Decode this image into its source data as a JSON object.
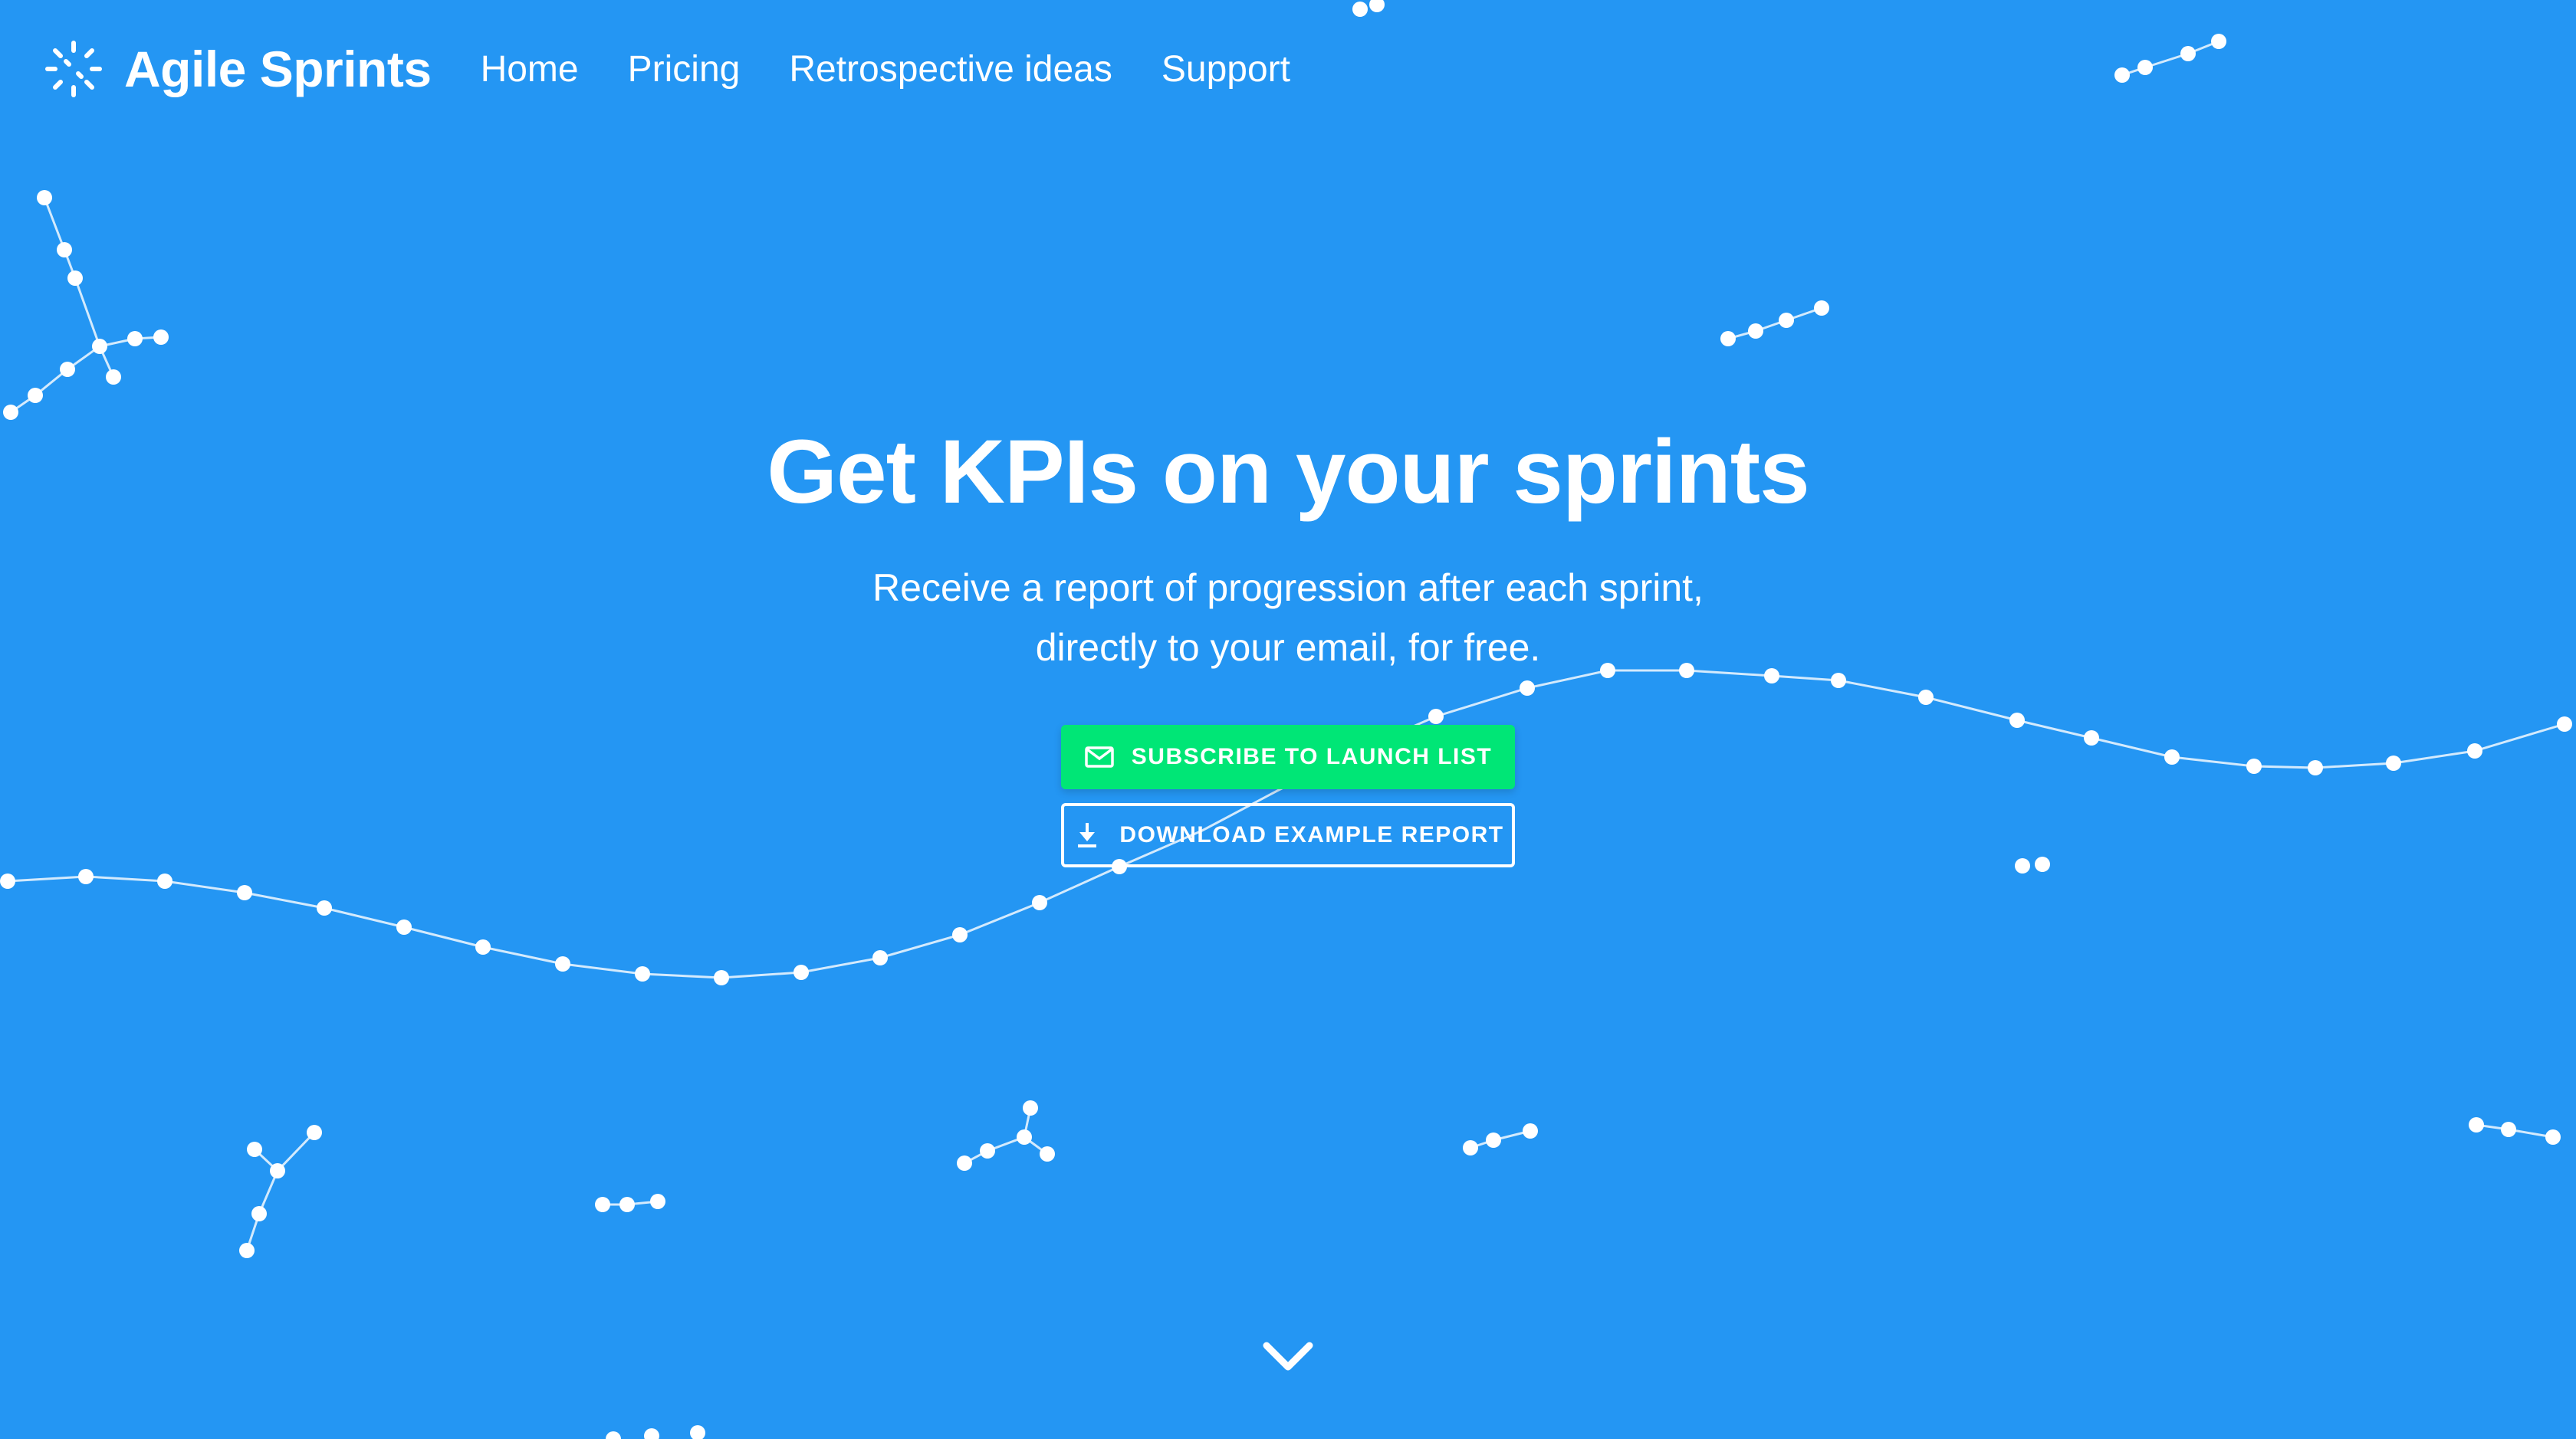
{
  "brand": {
    "name": "Agile Sprints",
    "logo_icon": "sparkle-logo-icon"
  },
  "nav": {
    "links": [
      "Home",
      "Pricing",
      "Retrospective ideas",
      "Support"
    ]
  },
  "hero": {
    "title": "Get KPIs on your sprints",
    "subtitle_lines": [
      "Receive a report of progression after each sprint,",
      "directly to your email, for free."
    ]
  },
  "buttons": {
    "subscribe": {
      "label": "SUBSCRIBE TO LAUNCH LIST",
      "icon": "mail-icon"
    },
    "download": {
      "label": "DOWNLOAD EXAMPLE REPORT",
      "icon": "download-icon"
    }
  },
  "scroll_icon": "chevron-down-icon",
  "colors": {
    "background": "#2496f3",
    "accent": "#00e676",
    "foreground": "#ffffff"
  }
}
